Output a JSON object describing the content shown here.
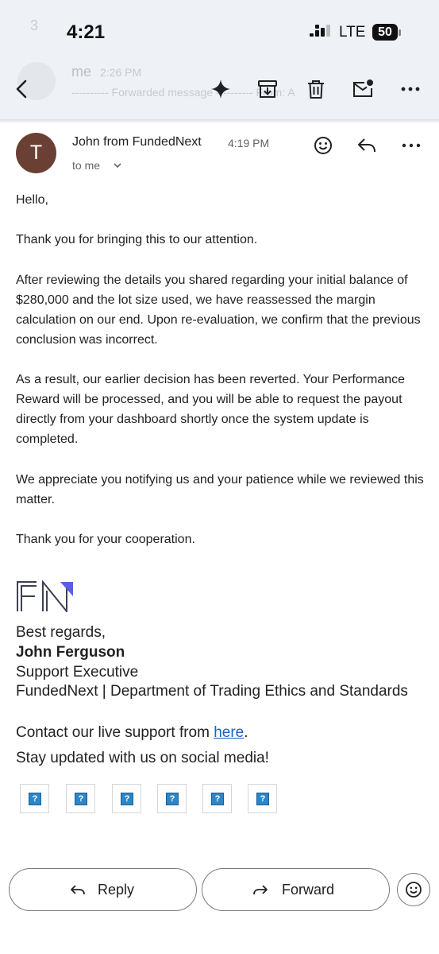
{
  "status_bar": {
    "time": "4:21",
    "network": "LTE",
    "battery": "50"
  },
  "background_thread": {
    "count": "3",
    "sender": "me",
    "time": "2:26 PM",
    "preview": "---------- Forwarded message ---------- From: A"
  },
  "toolbar": {
    "back_icon": "arrow-back-icon",
    "icons": [
      "sparkle-icon",
      "archive-icon",
      "delete-icon",
      "mark-unread-icon",
      "more-vert-icon"
    ]
  },
  "message": {
    "avatar_letter": "T",
    "sender": "John from FundedNext",
    "time": "4:19 PM",
    "recipient": "to me",
    "paragraphs": [
      "Hello,",
      "Thank you for bringing this to our attention.",
      "After reviewing the details you shared regarding your initial balance of $280,000 and the lot size used, we have reassessed the margin calculation on our end. Upon re-evaluation, we confirm that the previous conclusion was incorrect.",
      "As a result, our earlier decision has been reverted. Your Performance Reward will be processed, and you will be able to request the payout directly from your dashboard shortly once the system update is completed.",
      "We appreciate you notifying us and your patience while we reviewed this matter.",
      "Thank you for your cooperation."
    ]
  },
  "signature": {
    "closing": "Best regards,",
    "name": "John Ferguson",
    "title": "Support Executive",
    "department": "FundedNext | Department of Trading Ethics and Standards",
    "contact_prefix": "Contact our live support from ",
    "contact_link": "here",
    "contact_suffix": ".",
    "social_line": "Stay updated with us on social media!",
    "social_placeholders": [
      "?",
      "?",
      "?",
      "?",
      "?",
      "?"
    ]
  },
  "actions": {
    "reply": "Reply",
    "forward": "Forward"
  },
  "colors": {
    "accent": "#1a62c8",
    "avatar": "#6b4034",
    "topbar": "#eef1f6",
    "logo_accent": "#5b5fe6"
  }
}
